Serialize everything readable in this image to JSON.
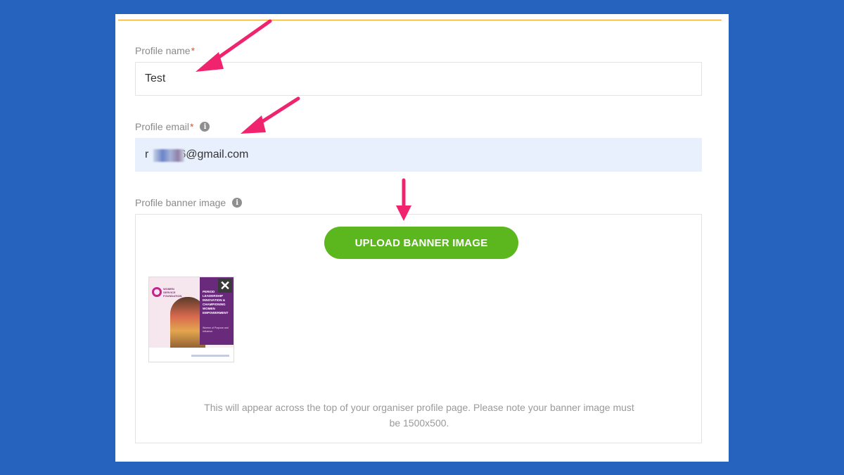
{
  "form": {
    "name_label": "Profile name",
    "name_required_mark": "*",
    "name_value": "Test",
    "email_label": "Profile email",
    "email_required_mark": "*",
    "email_value_start": "r",
    "email_value_end": "6@gmail.com",
    "banner_label": "Profile banner image",
    "info_glyph": "i",
    "upload_button": "UPLOAD BANNER IMAGE",
    "help_text": "This will appear across the top of your organiser profile page. Please note your banner image must be 1500x500."
  },
  "thumbnail": {
    "logo_text": "WOMEN SERVICE FOUNDATION",
    "title_text": "PERIOD LEADERSHIP INNOVATION & CHAMPIONING WOMEN EMPOWERMENT",
    "sub_text": "Women of Purpose and Influence",
    "close_glyph": "✕"
  },
  "icons": [
    "info-icon",
    "close-icon",
    "arrow-annotation"
  ],
  "colors": {
    "background": "#2563be",
    "accent_orange": "#f59a23",
    "required_red": "#e4572e",
    "upload_green": "#5cb71e",
    "email_fill": "#e8f0fe",
    "annotation_pink": "#f0246e"
  }
}
